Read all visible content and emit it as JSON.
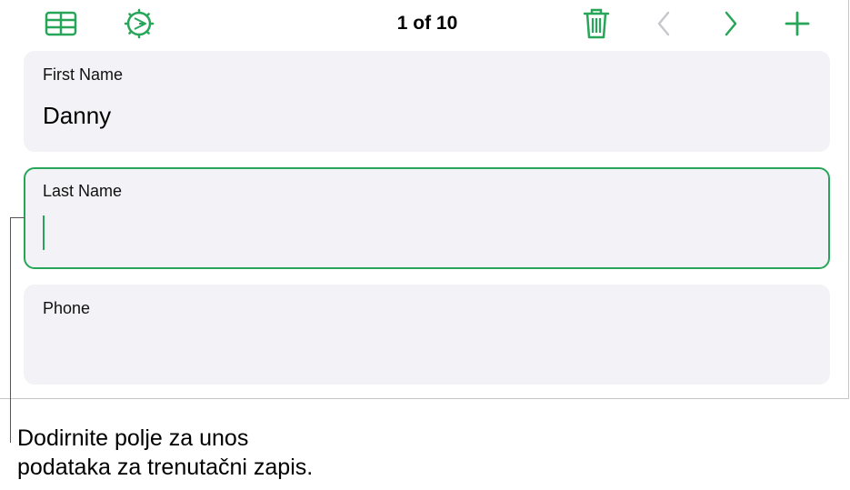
{
  "toolbar": {
    "record_counter": "1 of 10",
    "accent_color": "#27a659",
    "disabled_color": "#c7c7cc",
    "icons": [
      "table-icon",
      "form-settings-icon",
      "trash-icon",
      "chevron-left-icon",
      "chevron-right-icon",
      "plus-icon"
    ]
  },
  "fields": [
    {
      "label": "First Name",
      "value": "Danny"
    },
    {
      "label": "Last Name",
      "value": ""
    },
    {
      "label": "Phone",
      "value": ""
    }
  ],
  "callout": {
    "line1": "Dodirnite polje za unos",
    "line2": "podataka za trenutačni zapis."
  }
}
